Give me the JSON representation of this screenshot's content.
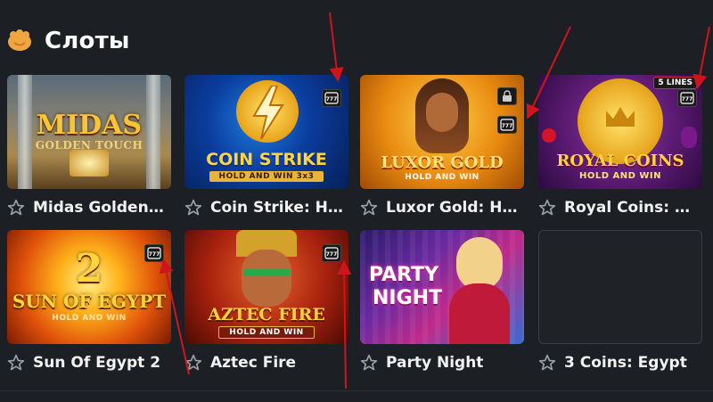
{
  "section": {
    "title": "Слоты",
    "icon": "gamepad-icon"
  },
  "games": [
    {
      "name": "Midas Golden T...",
      "thumb_title": "MIDAS",
      "thumb_sub": "GOLDEN TOUCH",
      "badge": null
    },
    {
      "name": "Coin Strike: Hol...",
      "thumb_title": "COIN STRIKE",
      "thumb_sub": "HOLD AND WIN 3x3",
      "badge": "slot-icon"
    },
    {
      "name": "Luxor Gold: Hol...",
      "thumb_title": "LUXOR GOLD",
      "thumb_sub": "HOLD AND WIN",
      "badge": "slot-icon"
    },
    {
      "name": "Royal Coins: Hol...",
      "thumb_title": "ROYAL COINS",
      "thumb_sub": "HOLD AND WIN",
      "badge": "slot-icon",
      "lines": "5 LINES"
    },
    {
      "name": "Sun Of Egypt 2",
      "thumb_title": "SUN OF EGYPT",
      "thumb_num": "2",
      "thumb_sub": "HOLD AND WIN",
      "badge": "slot-icon"
    },
    {
      "name": "Aztec Fire",
      "thumb_title": "AZTEC FIRE",
      "thumb_sub": "HOLD AND WIN",
      "badge": "slot-icon"
    },
    {
      "name": "Party Night",
      "thumb_title": "PARTY",
      "thumb_title2": "NIGHT",
      "badge": null
    },
    {
      "name": "3 Coins: Egypt",
      "thumb_title": "",
      "badge": null
    }
  ],
  "badge_label": "777",
  "colors": {
    "background": "#1c1f24",
    "arrow": "#d0141e"
  }
}
